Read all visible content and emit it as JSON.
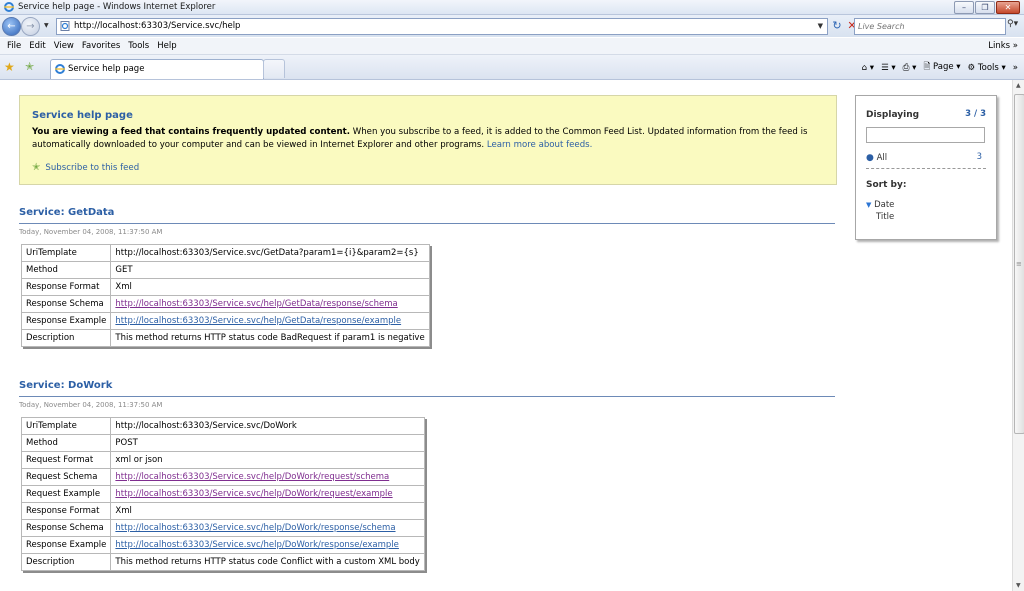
{
  "window": {
    "title": "Service help page - Windows Internet Explorer"
  },
  "address": {
    "url": "http://localhost:63303/Service.svc/help"
  },
  "search": {
    "placeholder": "Live Search"
  },
  "menu": {
    "items": [
      "File",
      "Edit",
      "View",
      "Favorites",
      "Tools",
      "Help"
    ],
    "links": "Links"
  },
  "tab": {
    "label": "Service help page"
  },
  "commandbar": {
    "page": "Page",
    "tools": "Tools"
  },
  "feed": {
    "title": "Service help page",
    "bold": "You are viewing a feed that contains frequently updated content.",
    "text": " When you subscribe to a feed, it is added to the Common Feed List. Updated information from the feed is automatically downloaded to your computer and can be viewed in Internet Explorer and other programs. ",
    "learn_more": "Learn more about feeds.",
    "subscribe": "Subscribe to this feed"
  },
  "services": [
    {
      "title": "Service: GetData",
      "date": "Today, November 04, 2008, 11:37:50 AM",
      "rows": [
        {
          "key": "UriTemplate",
          "value": "http://localhost:63303/Service.svc/GetData?param1={i}&param2={s}",
          "type": "text"
        },
        {
          "key": "Method",
          "value": "GET",
          "type": "text"
        },
        {
          "key": "Response Format",
          "value": "Xml",
          "type": "text"
        },
        {
          "key": "Response Schema",
          "value": "http://localhost:63303/Service.svc/help/GetData/response/schema",
          "type": "visited"
        },
        {
          "key": "Response Example",
          "value": "http://localhost:63303/Service.svc/help/GetData/response/example",
          "type": "link"
        },
        {
          "key": "Description",
          "value": "This method returns HTTP status code BadRequest if param1 is negative",
          "type": "text"
        }
      ]
    },
    {
      "title": "Service: DoWork",
      "date": "Today, November 04, 2008, 11:37:50 AM",
      "rows": [
        {
          "key": "UriTemplate",
          "value": "http://localhost:63303/Service.svc/DoWork",
          "type": "text"
        },
        {
          "key": "Method",
          "value": "POST",
          "type": "text"
        },
        {
          "key": "Request Format",
          "value": "xml or json",
          "type": "text"
        },
        {
          "key": "Request Schema",
          "value": "http://localhost:63303/Service.svc/help/DoWork/request/schema",
          "type": "visited"
        },
        {
          "key": "Request Example",
          "value": "http://localhost:63303/Service.svc/help/DoWork/request/example",
          "type": "visited"
        },
        {
          "key": "Response Format",
          "value": "Xml",
          "type": "text"
        },
        {
          "key": "Response Schema",
          "value": "http://localhost:63303/Service.svc/help/DoWork/response/schema",
          "type": "link"
        },
        {
          "key": "Response Example",
          "value": "http://localhost:63303/Service.svc/help/DoWork/response/example",
          "type": "link"
        },
        {
          "key": "Description",
          "value": "This method returns HTTP status code Conflict with a custom XML body",
          "type": "text"
        }
      ]
    }
  ],
  "sidebar": {
    "displaying": "Displaying",
    "count": "3 / 3",
    "all": "All",
    "all_count": "3",
    "sort_by": "Sort by:",
    "sort_date": "Date",
    "sort_title": "Title"
  },
  "colors": {
    "link": "#2c5fa5",
    "visited": "#7f2d8f",
    "feed_bg": "#fafac0"
  }
}
